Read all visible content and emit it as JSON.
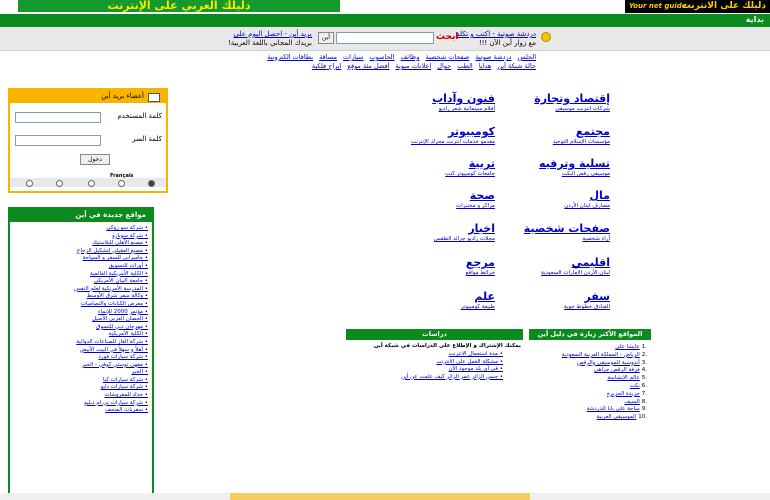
{
  "banner": {
    "ad_text": "دليلك العربي على الإنترنت",
    "logo_sub": "Your net guide",
    "logo_main": "دليلك على الانترنت"
  },
  "greenbar": {
    "label": "بداية"
  },
  "infobar": {
    "chat_title": "دردشة صوتية - اكتب و تكلم",
    "chat_sub": "مع زوار أين الآن !!!",
    "search_button": "ابحث",
    "go_button": "أين",
    "mail_line1": "بريد أين - احصل اليوم على",
    "mail_line2": "بريدك المجاني باللغة العربية!"
  },
  "links_row1": [
    "الحلس",
    "دردشة صوتية",
    "صفحات شخصية",
    "وظائف",
    "الحاسوب",
    "سيارات",
    "مساقة",
    "بطاقات الكترونية"
  ],
  "links_row2": [
    "حالة شبكة أين",
    "هدايا",
    "الطب",
    "جوال",
    "اعلانات مبوبة",
    "أفضل مئة موقع",
    "ابراج فلكية"
  ],
  "categories": [
    {
      "title": "إقتصاد وتجارة",
      "sub": "شركات  انترنت  موسيقى"
    },
    {
      "title": "فنون وآداب",
      "sub": "أفلام سينمائية  شعر  راديو"
    },
    {
      "title": "مجتمع",
      "sub": "مؤسسات  الإسلام  التوحيد"
    },
    {
      "title": "كومبيوتر",
      "sub": "مقدمو خدمات انترنت  محرك الإنترنت"
    },
    {
      "title": "تسلية وترفيه",
      "sub": "موسيقى  رقص  النكت"
    },
    {
      "title": "تربية",
      "sub": "جامعات  كومبيوتر  كتب"
    },
    {
      "title": "مال",
      "sub": "مصارف  لبنان  الأردن"
    },
    {
      "title": "صحة",
      "sub": "مراكز و مختبرات"
    },
    {
      "title": "صفحات شخصية",
      "sub": "آراء شخصية"
    },
    {
      "title": "اخبار",
      "sub": "مجلات  راديو  جرائد  الطقس"
    },
    {
      "title": "اقليمي",
      "sub": "لبنان  الأردن  الإمارات  السعودية"
    },
    {
      "title": "مرجع",
      "sub": "خرائط  مواقع"
    },
    {
      "title": "سفر",
      "sub": "الفنادق  خطوط جوية"
    },
    {
      "title": "علم",
      "sub": "طبيعة  كومبيوتر"
    }
  ],
  "login": {
    "title": "أعضاء بريد أين",
    "username_label": "كلمة المستخدم",
    "password_label": "كلمة السر",
    "submit": "دخول",
    "language": "Français"
  },
  "new_sites": {
    "title": "مواقع جديدة في أين",
    "items": [
      "شركة سو زوكي",
      "شركة سوبارو",
      "مصنع الأهلي للبلاستيك",
      "مصنع العقيلي لتشكيل الزجاج",
      "جاميرابي للسفر و السياحة",
      "أورات للتسويق",
      "الكلية الأمريكية العالمية",
      "جامعة البيان الأمريكي",
      "المدرسة الأمريكية لعلم النفس",
      "وكالة سفر شرق الأوسط",
      "معرض الكتابات والتصاميات",
      "مؤتمر 2000 للإنماء",
      "الحصان العربي الأصيل",
      "مهرجان دبي للتسوق",
      "الكلية الأمريكية",
      "شركة الغاز للصناعات الدوائية",
      "أهلاً و سهلاً في البيت الأبيض",
      "شركة سيارات فورد",
      "مقهى توستي كوفي - الخبر",
      "الخبر",
      "شركة سيارات كيا",
      "شركة سيارات دايو",
      "حداد للمفروشات",
      "شركة سيارات بي ام دبليو",
      "سفريات المنحف"
    ]
  },
  "most_visited": {
    "title": "المواقع الأكثر زيارة في دليل أين",
    "items": [
      "عايشا علي",
      "الرياض - المملكة العربية السعودية",
      "أندوسية للموسيقى والرقص",
      "فرقة الرقص جراهي",
      "عالم الإنشاسة",
      "نكت",
      "جريدة الجزيرة",
      "السيف",
      "ساحة على بابا للدردشة",
      "الموسيقى العربية"
    ]
  },
  "studies": {
    "title": "دراسات",
    "intro": "يمكنك الإشتراك و الإطلاع على الدراسات في شبكة أين",
    "items": [
      "مدة استعمال الانترنت",
      "مشكلة العمل على الانترنت",
      "في أي بلد موجود الآن",
      "جنس الزائر عمر الزائر كيف علمت عن أين"
    ]
  },
  "colors": {
    "green": "#0b8a1e",
    "gold": "#f7b500",
    "link": "#0000cc"
  }
}
